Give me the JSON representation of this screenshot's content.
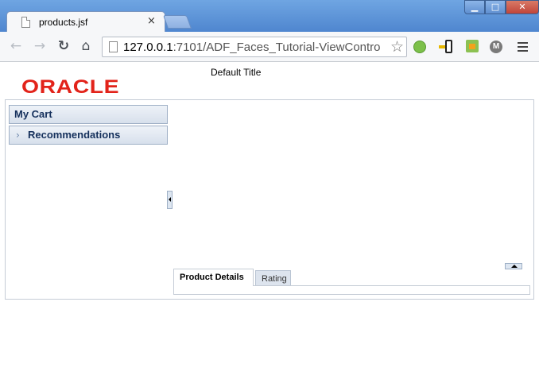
{
  "browser": {
    "tab_title": "products.jsf",
    "tab_close": "×",
    "url_host": "127.0.0.1",
    "url_rest": ":7101/ADF_Faces_Tutorial-ViewContro",
    "window_buttons": {
      "minimize": "▁",
      "maximize": "□",
      "close": "✕"
    },
    "nav": {
      "back": "←",
      "forward": "→",
      "reload": "↻",
      "home": "⌂",
      "star": "☆"
    },
    "extension_moto": "M"
  },
  "page": {
    "logo_text": "ORACLE",
    "title": "Default Title",
    "accordion": {
      "my_cart": "My Cart",
      "recommendations": "Recommendations",
      "chevron": "›"
    },
    "tabs": {
      "product_details": "Product Details",
      "rating": "Rating"
    }
  },
  "colors": {
    "oracle_red": "#e2231a",
    "accent_blue": "#15305c",
    "panel_border": "#c5ccd6"
  }
}
